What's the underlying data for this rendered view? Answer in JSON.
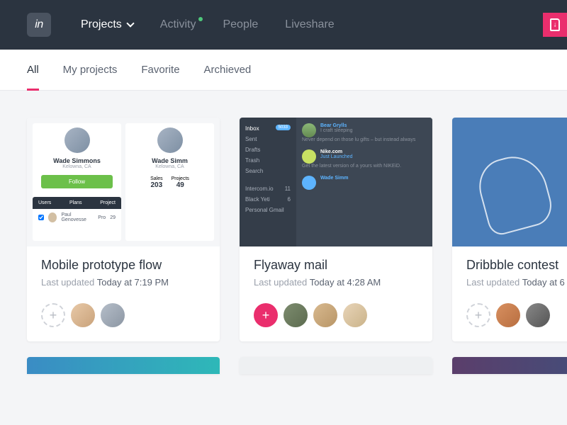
{
  "logo_text": "in",
  "nav": {
    "projects": "Projects",
    "activity": "Activity",
    "people": "People",
    "liveshare": "Liveshare"
  },
  "tabs": {
    "all": "All",
    "my": "My projects",
    "fav": "Favorite",
    "arch": "Archieved"
  },
  "meta_label": "Last updated ",
  "cards": [
    {
      "title": "Mobile prototype flow",
      "updated": "Today at 7:19 PM"
    },
    {
      "title": "Flyaway mail",
      "updated": "Today at 4:28 AM"
    },
    {
      "title": "Dribbble contest",
      "updated": "Today at 6"
    }
  ],
  "thumb1": {
    "name1": "Wade Simmons",
    "loc1": "Kelowna, CA",
    "follow": "Follow",
    "name2": "Wade Simm",
    "loc2": "Kelowna, CA",
    "sales_lbl": "Sales",
    "sales": "203",
    "proj_lbl": "Projects",
    "proj": "49",
    "h1": "Users",
    "h2": "Plans",
    "h3": "Project",
    "row_name": "Paul Genovesse",
    "row_plan": "Pro",
    "row_n": "29"
  },
  "thumb2": {
    "inbox": "Inbox",
    "inbox_badge": "5033",
    "sent": "Sent",
    "drafts": "Drafts",
    "trash": "Trash",
    "search": "Search",
    "intercom": "Intercom.io",
    "intercom_n": "11",
    "blackyeti": "Black Yeti",
    "blackyeti_n": "6",
    "gmail": "Personal Gmail",
    "p1_name": "Bear Grylls",
    "p1_sub": "I craft sleeping",
    "p1_body": "Never depend on those lu gifts – but instead always",
    "p2_name": "Nike.com",
    "p2_sub": "Just Launched",
    "p2_body": "Get the latest version of a yours with NIKEiD.",
    "p3_name": "Wade Simm"
  }
}
